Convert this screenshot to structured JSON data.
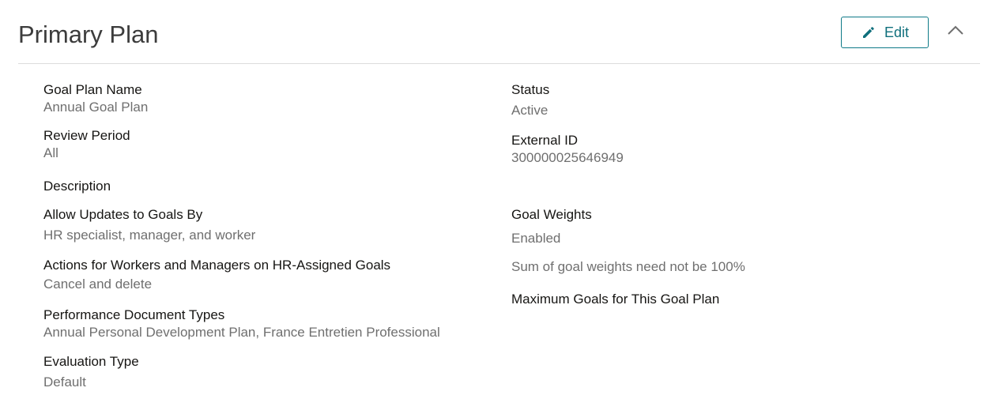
{
  "header": {
    "title": "Primary Plan",
    "edit_label": "Edit",
    "edit_icon": "pencil-icon",
    "collapse_icon": "chevron-up-icon",
    "accent_color": "#0f7a88"
  },
  "left_fields": [
    {
      "label": "Goal Plan Name",
      "value": "Annual Goal Plan"
    },
    {
      "label": "Review Period",
      "value": "All"
    },
    {
      "label": "Description",
      "value": ""
    },
    {
      "label": "Allow Updates to Goals By",
      "value": "HR specialist, manager, and worker"
    },
    {
      "label": "Actions for Workers and Managers on HR-Assigned Goals",
      "value": "Cancel and delete"
    },
    {
      "label": "Performance Document Types",
      "value": "Annual Personal Development Plan, France Entretien Professional"
    },
    {
      "label": "Evaluation Type",
      "value": "Default"
    }
  ],
  "right_fields": {
    "status": {
      "label": "Status",
      "value": "Active"
    },
    "external_id": {
      "label": "External ID",
      "value": "300000025646949"
    },
    "goal_weights": {
      "label": "Goal Weights",
      "value": "Enabled",
      "note": "Sum of goal weights need not be 100%"
    },
    "max_goals": {
      "label": "Maximum Goals for This Goal Plan",
      "value": ""
    }
  }
}
